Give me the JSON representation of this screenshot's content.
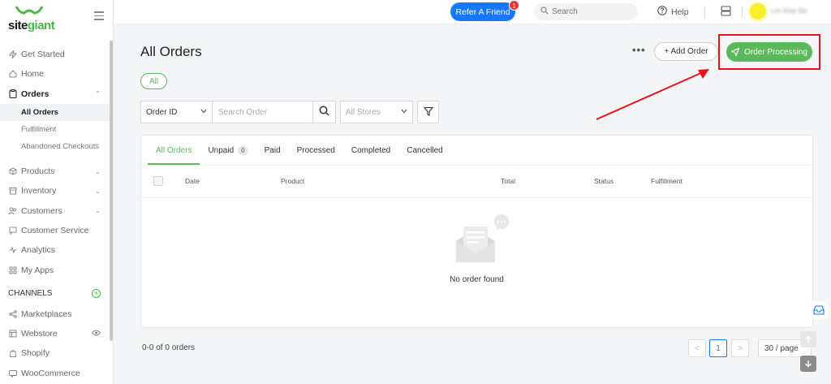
{
  "brand": {
    "logo_prefix": "site",
    "logo_accent": "giant",
    "accent_color": "#5cb85c",
    "primary_color": "#1677ff"
  },
  "sidebar": {
    "items": [
      {
        "label": "Get Started",
        "icon": "bolt-icon"
      },
      {
        "label": "Home",
        "icon": "home-icon"
      },
      {
        "label": "Orders",
        "icon": "clipboard-icon"
      },
      {
        "label": "Products",
        "icon": "box-icon"
      },
      {
        "label": "Inventory",
        "icon": "archive-icon"
      },
      {
        "label": "Customers",
        "icon": "users-icon"
      },
      {
        "label": "Customer Service",
        "icon": "chat-icon"
      },
      {
        "label": "Analytics",
        "icon": "pulse-icon"
      },
      {
        "label": "My Apps",
        "icon": "grid-icon"
      }
    ],
    "orders_sub": [
      "All Orders",
      "Fulfillment",
      "Abandoned Checkouts"
    ],
    "channels_label": "CHANNELS",
    "channels": [
      {
        "label": "Marketplaces",
        "icon": "share-icon"
      },
      {
        "label": "Webstore",
        "icon": "window-icon"
      },
      {
        "label": "Shopify",
        "icon": "bag-icon"
      },
      {
        "label": "WooCommerce",
        "icon": "cart-icon"
      }
    ]
  },
  "topbar": {
    "refer_label": "Refer A Friend",
    "refer_badge": "1",
    "search_placeholder": "Search",
    "help_label": "Help",
    "username": "Lim Khai Sin"
  },
  "main": {
    "title": "All Orders",
    "more": "•••",
    "add_order_label": "+ Add Order",
    "order_processing_label": "Order Processing",
    "chip_all": "All",
    "filter": {
      "field_select": "Order ID",
      "search_placeholder": "Search Order",
      "store_select": "All Stores"
    },
    "tabs": [
      {
        "label": "All Orders"
      },
      {
        "label": "Unpaid",
        "count": "0"
      },
      {
        "label": "Paid"
      },
      {
        "label": "Processed"
      },
      {
        "label": "Completed"
      },
      {
        "label": "Cancelled"
      }
    ],
    "columns": [
      "Date",
      "Product",
      "Total",
      "Status",
      "Fulfillment"
    ],
    "empty_text": "No order found",
    "footer_count": "0-0 of 0 orders",
    "pagination": {
      "prev": "<",
      "current": "1",
      "next": ">",
      "per_page": "30 / page"
    }
  }
}
